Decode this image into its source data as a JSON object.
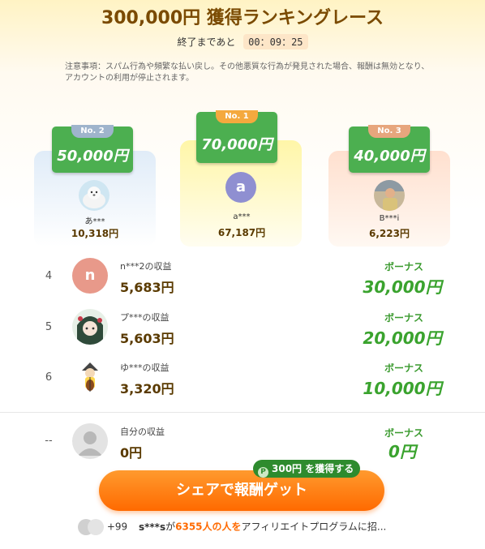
{
  "header": {
    "title": "300,000円 獲得ランキングレース",
    "countdown_label": "終了まであと",
    "countdown": "00：09：25",
    "notice": "注意事項：スパム行為や頻繁な払い戻し。その他悪質な行為が発見された場合、報酬は無効となり、アカウントの利用が停止されます。"
  },
  "podium": [
    {
      "rank_label": "No. 2",
      "prize": "50,000円",
      "name": "あ***",
      "earnings": "10,318円",
      "avatar": "seal-photo-avatar"
    },
    {
      "rank_label": "No. 1",
      "prize": "70,000円",
      "name": "a***",
      "earnings": "67,187円",
      "avatar": "letter-avatar",
      "avatar_letter": "a"
    },
    {
      "rank_label": "No. 3",
      "prize": "40,000円",
      "name": "B***i",
      "earnings": "6,223円",
      "avatar": "person-photo-avatar"
    }
  ],
  "rows": [
    {
      "rank": "4",
      "avatar_letter": "n",
      "name": "n***2の収益",
      "earnings": "5,683円",
      "bonus_label": "ボーナス",
      "bonus": "30,000円"
    },
    {
      "rank": "5",
      "name": "プ***の収益",
      "earnings": "5,603円",
      "bonus_label": "ボーナス",
      "bonus": "20,000円"
    },
    {
      "rank": "6",
      "name": "ゆ***の収益",
      "earnings": "3,320円",
      "bonus_label": "ボーナス",
      "bonus": "10,000円"
    }
  ],
  "self_row": {
    "rank": "--",
    "name": "自分の収益",
    "earnings": "0円",
    "bonus_label": "ボーナス",
    "bonus": "0円"
  },
  "cta": {
    "label": "シェアで報酬ゲット",
    "bubble": "300円 を獲得する",
    "bubble_icon": "P"
  },
  "footer": {
    "plus_count": "+99",
    "user": "s***s",
    "part_ga": "が",
    "count": "6355人の人を",
    "rest": "アフィリエイトプログラムに招..."
  },
  "colors": {
    "brand_green": "#4caf50",
    "cta_orange": "#ff6a00",
    "bonus_green": "#3aa32e",
    "title_brown": "#7a4a00"
  }
}
